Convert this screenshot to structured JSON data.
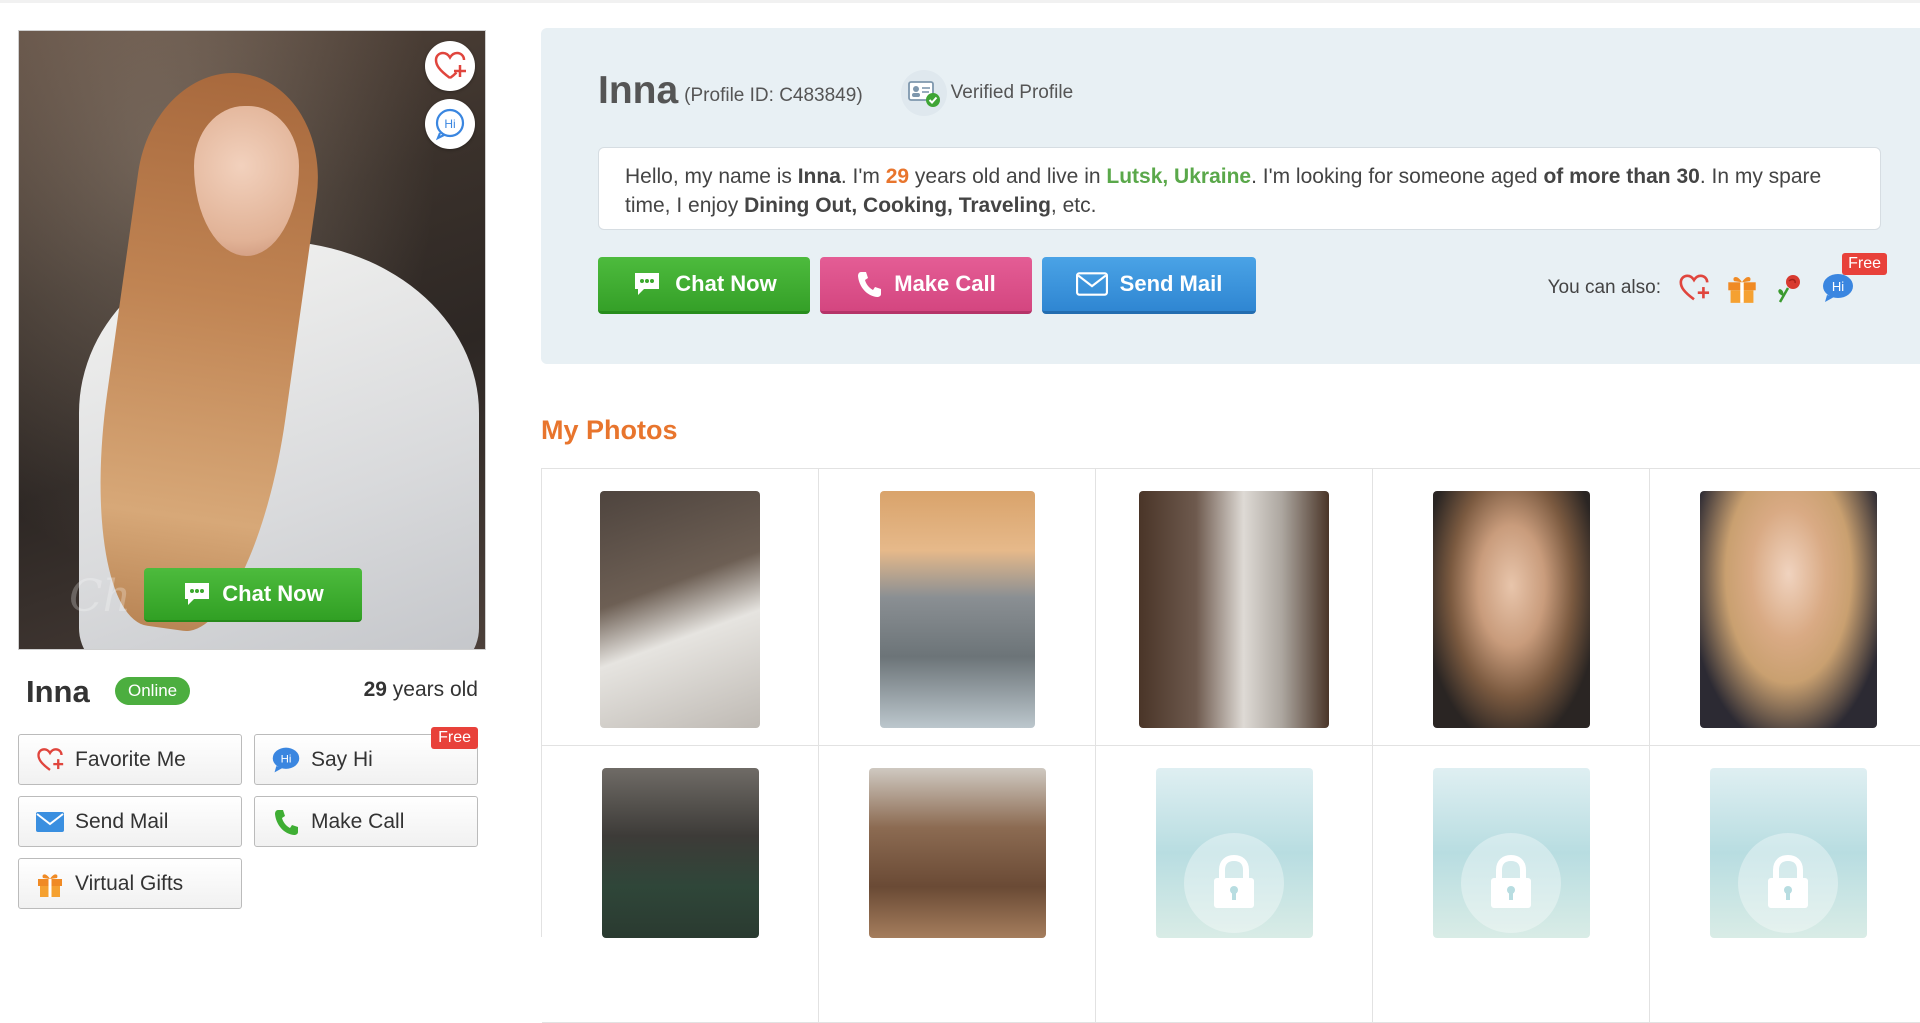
{
  "profile": {
    "name": "Inna",
    "profile_id": "(Profile ID: C483849)",
    "verified_label": "Verified Profile",
    "status": "Online",
    "age_number": "29",
    "age_suffix": "years old"
  },
  "main_photo": {
    "chat_button": "Chat Now",
    "watermark": "Ch    com"
  },
  "left_actions": {
    "favorite": "Favorite Me",
    "say_hi": "Say Hi",
    "free_tag": "Free",
    "send_mail": "Send Mail",
    "make_call": "Make Call",
    "virtual_gifts": "Virtual Gifts"
  },
  "intro": {
    "p1": "Hello, my name is ",
    "name": "Inna",
    "p2": ". I'm ",
    "age": "29",
    "p3": " years old and live in ",
    "city": "Lutsk, Ukraine",
    "p4": ". I'm looking for someone aged ",
    "age_pref": "of more than 30",
    "p5": ". In my spare time, I enjoy ",
    "hobbies": "Dining Out, Cooking, Traveling",
    "p6": ", etc."
  },
  "buttons": {
    "chat": "Chat Now",
    "call": "Make Call",
    "mail": "Send Mail"
  },
  "also": {
    "label": "You can also:",
    "free_tag": "Free",
    "hi_text": "Hi"
  },
  "photos": {
    "heading": "My Photos"
  },
  "colors": {
    "orange_accent": "#e8752d",
    "green": "#4cae3f",
    "pink": "#d44680",
    "blue": "#2f86d2",
    "free_red": "#e8413a"
  }
}
